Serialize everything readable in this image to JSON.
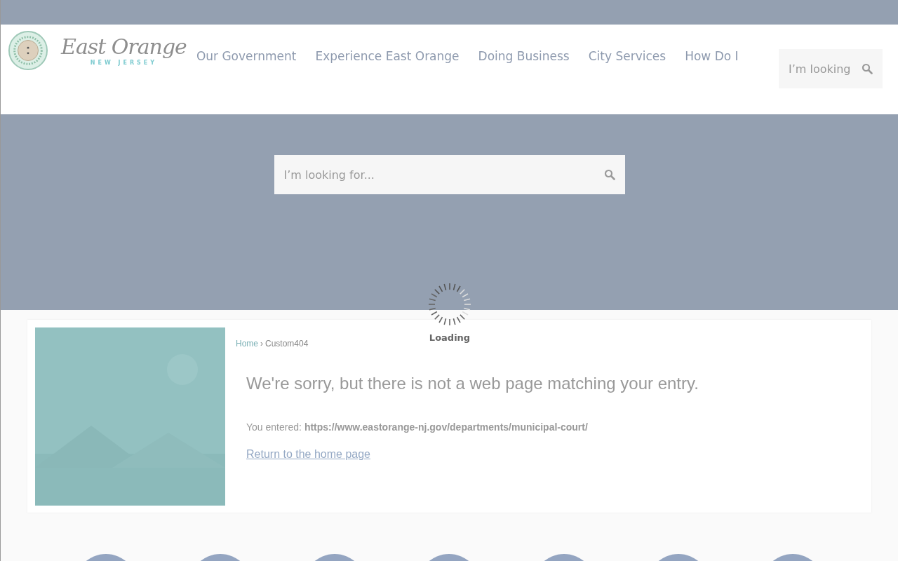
{
  "logo": {
    "name": "East Orange",
    "subtitle": "NEW JERSEY"
  },
  "nav": [
    {
      "label": "Our Government"
    },
    {
      "label": "Experience East Orange"
    },
    {
      "label": "Doing Business"
    },
    {
      "label": "City Services"
    },
    {
      "label": "How Do I"
    }
  ],
  "header_search": {
    "placeholder": "I’m looking"
  },
  "hero_search": {
    "placeholder": "I’m looking for..."
  },
  "loading": {
    "label": "Loading"
  },
  "breadcrumb": [
    {
      "label": "Home",
      "kind": "link"
    },
    {
      "label": "›",
      "kind": "separator"
    },
    {
      "label": "Custom404",
      "kind": "current"
    }
  ],
  "message": "We're sorry, but there is not a web page matching your entry.",
  "entered": {
    "label": "You entered:",
    "url": "https://www.eastorange-nj.gov/departments/municipal-court/"
  },
  "return_link": "Return to the home page",
  "quick_links": [
    {
      "kind": "circle"
    },
    {
      "kind": "circle"
    },
    {
      "kind": "circle"
    },
    {
      "kind": "circle"
    },
    {
      "kind": "circle"
    },
    {
      "kind": "circle"
    },
    {
      "kind": "circle"
    }
  ]
}
